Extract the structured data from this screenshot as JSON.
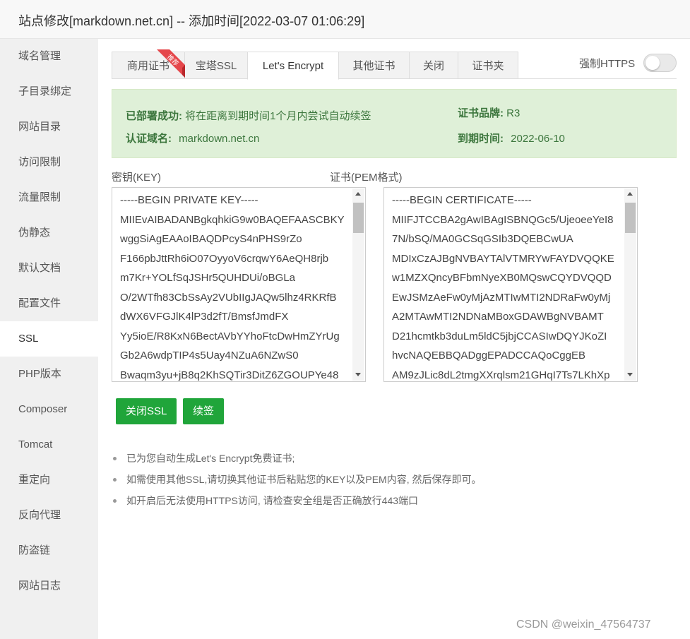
{
  "dialog": {
    "title": "站点修改[markdown.net.cn] -- 添加时间[2022-03-07 01:06:29]"
  },
  "sidebar": {
    "items": [
      {
        "label": "域名管理"
      },
      {
        "label": "子目录绑定"
      },
      {
        "label": "网站目录"
      },
      {
        "label": "访问限制"
      },
      {
        "label": "流量限制"
      },
      {
        "label": "伪静态"
      },
      {
        "label": "默认文档"
      },
      {
        "label": "配置文件"
      },
      {
        "label": "SSL",
        "active": true
      },
      {
        "label": "PHP版本"
      },
      {
        "label": "Composer"
      },
      {
        "label": "Tomcat"
      },
      {
        "label": "重定向"
      },
      {
        "label": "反向代理"
      },
      {
        "label": "防盗链"
      },
      {
        "label": "网站日志"
      }
    ]
  },
  "tabs": [
    {
      "label": "商用证书",
      "badge": "推荐"
    },
    {
      "label": "宝塔SSL"
    },
    {
      "label": "Let's Encrypt",
      "active": true
    },
    {
      "label": "其他证书"
    },
    {
      "label": "关闭"
    },
    {
      "label": "证书夹"
    }
  ],
  "force_https": {
    "label": "强制HTTPS",
    "enabled": false
  },
  "status": {
    "deployed_label": "已部署成功:",
    "deployed_text": "将在距离到期时间1个月内尝试自动续签",
    "domain_label": "认证域名:",
    "domain_value": "markdown.net.cn",
    "brand_label": "证书品牌:",
    "brand_value": "R3",
    "expire_label": "到期时间:",
    "expire_value": "2022-06-10"
  },
  "key_field": {
    "label": "密钥(KEY)",
    "lines": [
      "-----BEGIN PRIVATE KEY-----",
      "MIIEvAIBADANBgkqhkiG9w0BAQEFAASCBKY",
      "wggSiAgEAAoIBAQDPcyS4nPHS9rZo",
      "F166pbJttRh6iO07OyyoV6crqwY6AeQH8rjb",
      "m7Kr+YOLfSqJSHr5QUHDUi/oBGLa",
      "O/2WTfh83CbSsAy2VUbIIgJAQw5lhz4RKRfB",
      "dWX6VFGJlK4lP3d2fT/BmsfJmdFX",
      "Yy5ioE/R8KxN6BectAVbYYhoFtcDwHmZYrUg",
      "Gb2A6wdpTIP4s5Uay4NZuA6NZwS0",
      "Bwaqm3yu+jB8q2KhSQTir3DitZ6ZGOUPYe48"
    ]
  },
  "cert_field": {
    "label": "证书(PEM格式)",
    "lines": [
      "-----BEGIN CERTIFICATE-----",
      "MIIFJTCCBA2gAwIBAgISBNQGc5/UjeoeeYeI8",
      "7N/bSQ/MA0GCSqGSIb3DQEBCwUA",
      "MDIxCzAJBgNVBAYTAlVTMRYwFAYDVQQKE",
      "w1MZXQncyBFbmNyeXB0MQswCQYDVQQD",
      "EwJSMzAeFw0yMjAzMTIwMTI2NDRaFw0yMj",
      "A2MTAwMTI2NDNaMBoxGDAWBgNVBAMT",
      "D21hcmtkb3duLm5ldC5jbjCCASIwDQYJKoZI",
      "hvcNAQEBBQADggEPADCCAQoCggEB",
      "AM9zJLic8dL2tmgXXrqlsm21GHqI7Ts7LKhXp"
    ]
  },
  "buttons": {
    "close_ssl": "关闭SSL",
    "renew": "续签"
  },
  "tips": [
    "已为您自动生成Let's Encrypt免费证书;",
    "如需使用其他SSL,请切换其他证书后粘贴您的KEY以及PEM内容, 然后保存即可。",
    "如开启后无法使用HTTPS访问, 请检查安全组是否正确放行443端口"
  ],
  "watermark": "CSDN @weixin_47564737",
  "colors": {
    "accent_green": "#20a53a",
    "success_bg": "#dff0d8",
    "success_text": "#3c763d",
    "badge_red": "#e5474b"
  }
}
